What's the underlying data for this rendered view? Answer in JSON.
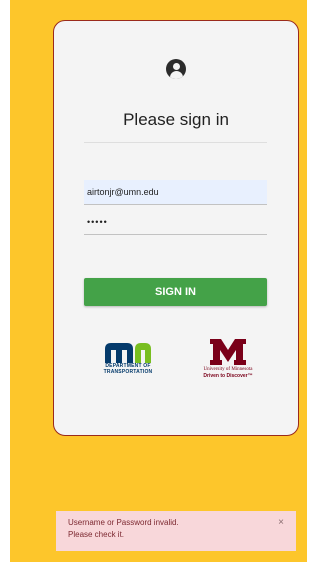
{
  "login": {
    "title": "Please sign in",
    "email_value": "airtonjr@umn.edu",
    "password_value": "•••••",
    "signin_label": "SIGN IN"
  },
  "logos": {
    "mndot_line1": "DEPARTMENT OF",
    "mndot_line2": "TRANSPORTATION",
    "umn_line1": "University of Minnesota",
    "umn_line2": "Driven to Discover™"
  },
  "toast": {
    "line1": "Username or Password invalid.",
    "line2": "Please check it.",
    "close": "×"
  },
  "colors": {
    "background": "#fdc62b",
    "card": "#f4f4f4",
    "card_border": "#9a2a1c",
    "button": "#44a248",
    "toast": "#f8d7da",
    "mndot_blue": "#043a6b",
    "mndot_green": "#78be20",
    "umn_maroon": "#7a0019"
  },
  "icons": {
    "avatar": "account-circle-icon",
    "mndot": "mndot-logo",
    "umn": "umn-block-m-logo"
  }
}
